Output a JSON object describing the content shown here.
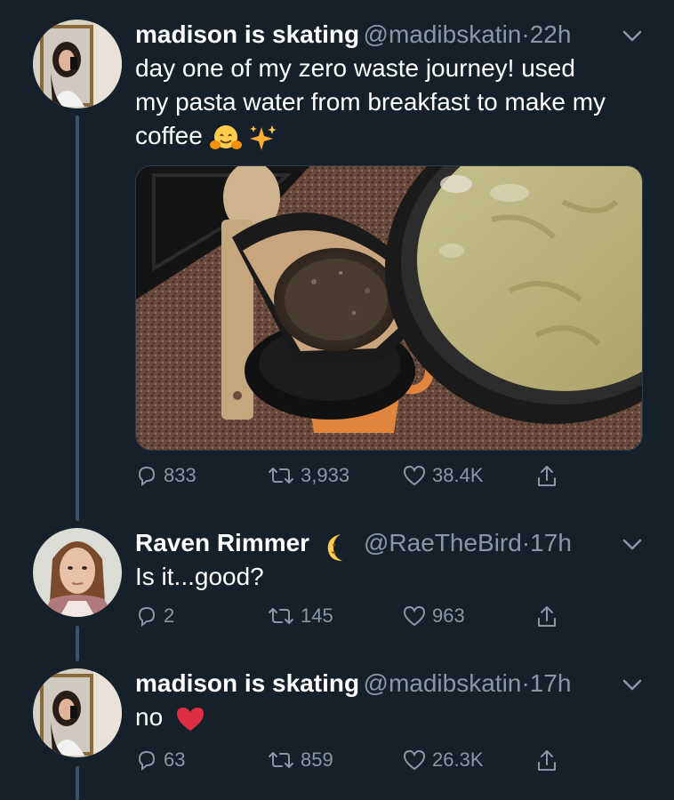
{
  "tweets": [
    {
      "name": "madison is skating",
      "handle": "@madibskatin",
      "separator": "·",
      "time": "22h",
      "text_lines": [
        "day one of my zero waste journey! used",
        "my pasta water from breakfast to make my",
        "coffee"
      ],
      "emojis": [
        "hugging-face",
        "sparkles"
      ],
      "replies": "833",
      "retweets": "3,933",
      "likes": "38.4K"
    },
    {
      "name": "Raven Rimmer",
      "name_emoji": "crescent-moon-face",
      "handle": "@RaeTheBird",
      "separator": "·",
      "time": "17h",
      "text": "Is it...good?",
      "replies": "2",
      "retweets": "145",
      "likes": "963"
    },
    {
      "name": "madison is skating",
      "handle": "@madibskatin",
      "separator": "·",
      "time": "17h",
      "text": "no",
      "text_emoji": "red-heart",
      "replies": "63",
      "retweets": "859",
      "likes": "26.3K"
    }
  ],
  "colors": {
    "background": "#15202b",
    "secondary_text": "#8899a6",
    "thread_line": "#3d5466"
  }
}
